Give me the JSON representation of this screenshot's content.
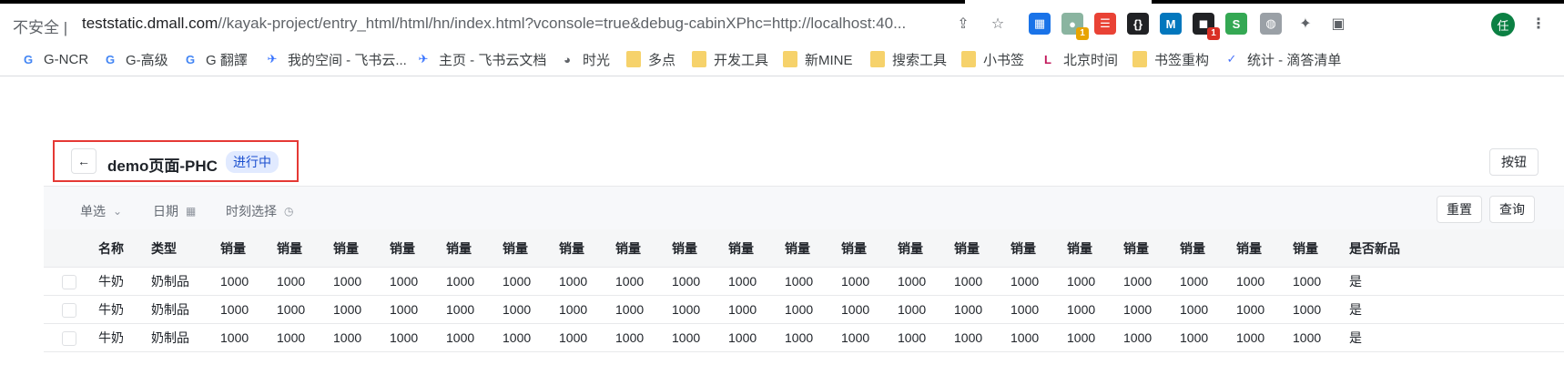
{
  "browser": {
    "security_label": "不安全",
    "url_host": "teststatic.dmall.com",
    "url_path": "//kayak-project/entry_html/html/hn/index.html?vconsole=true&debug-cabinXPhc=http://localhost:40...",
    "extensions": [
      {
        "name": "grid-ext",
        "color": "#1a73e8",
        "glyph": "▦",
        "badge": ""
      },
      {
        "name": "circle-ext",
        "color": "#8ab4a0",
        "glyph": "●",
        "badge": "1",
        "badge_color": "#e8a400"
      },
      {
        "name": "red-ext",
        "color": "#e94235",
        "glyph": "☰",
        "badge": ""
      },
      {
        "name": "json-ext",
        "color": "#202124",
        "glyph": "{}",
        "badge": ""
      },
      {
        "name": "m-ext",
        "color": "#0277bd",
        "glyph": "M",
        "badge": ""
      },
      {
        "name": "black-ext",
        "color": "#202124",
        "glyph": "◼",
        "badge": "1",
        "badge_color": "#d93025"
      },
      {
        "name": "s-ext",
        "color": "#34a853",
        "glyph": "S",
        "badge": ""
      },
      {
        "name": "globe-ext",
        "color": "#9aa0a6",
        "glyph": "◍",
        "badge": "",
        "badge_color": "#5f6368"
      }
    ],
    "avatar_text": "任"
  },
  "bookmarks": [
    {
      "label": "G-NCR",
      "icon": "google-icon",
      "glyph": "G",
      "color": "#4285f4"
    },
    {
      "label": "G-高级",
      "icon": "google-icon",
      "glyph": "G",
      "color": "#4285f4"
    },
    {
      "label": "G 翻譯",
      "icon": "translate-icon",
      "glyph": "G",
      "color": "#4285f4"
    },
    {
      "label": "我的空间 - 飞书云...",
      "icon": "feishu-icon",
      "glyph": "✈",
      "color": "#3370ff"
    },
    {
      "label": "主页 - 飞书云文档",
      "icon": "feishu-icon",
      "glyph": "✈",
      "color": "#3370ff"
    },
    {
      "label": "时光",
      "icon": "globe-icon",
      "glyph": "◕",
      "color": "#5f6368"
    },
    {
      "label": "多点",
      "icon": "folder-icon"
    },
    {
      "label": "开发工具",
      "icon": "folder-icon"
    },
    {
      "label": "新MINE",
      "icon": "folder-icon"
    },
    {
      "label": "搜索工具",
      "icon": "folder-icon"
    },
    {
      "label": "小书签",
      "icon": "folder-icon"
    },
    {
      "label": "北京时间",
      "icon": "clock-icon",
      "glyph": "L",
      "color": "#c2185b"
    },
    {
      "label": "书签重构",
      "icon": "folder-icon"
    },
    {
      "label": "统计 - 滴答清单",
      "icon": "check-icon",
      "glyph": "✓",
      "color": "#4772fa"
    }
  ],
  "page": {
    "title": "demo页面-PHC",
    "status": "进行中",
    "back_glyph": "←",
    "right_button": "按钮"
  },
  "filters": {
    "single_select": "单选",
    "date": "日期",
    "time_picker": "时刻选择",
    "reset": "重置",
    "query": "查询"
  },
  "table": {
    "headers": [
      "名称",
      "类型",
      "销量",
      "销量",
      "销量",
      "销量",
      "销量",
      "销量",
      "销量",
      "销量",
      "销量",
      "销量",
      "销量",
      "销量",
      "销量",
      "销量",
      "销量",
      "销量",
      "销量",
      "销量",
      "销量",
      "销量",
      "是否新品"
    ],
    "rows": [
      [
        "牛奶",
        "奶制品",
        "1000",
        "1000",
        "1000",
        "1000",
        "1000",
        "1000",
        "1000",
        "1000",
        "1000",
        "1000",
        "1000",
        "1000",
        "1000",
        "1000",
        "1000",
        "1000",
        "1000",
        "1000",
        "1000",
        "1000",
        "是"
      ],
      [
        "牛奶",
        "奶制品",
        "1000",
        "1000",
        "1000",
        "1000",
        "1000",
        "1000",
        "1000",
        "1000",
        "1000",
        "1000",
        "1000",
        "1000",
        "1000",
        "1000",
        "1000",
        "1000",
        "1000",
        "1000",
        "1000",
        "1000",
        "是"
      ],
      [
        "牛奶",
        "奶制品",
        "1000",
        "1000",
        "1000",
        "1000",
        "1000",
        "1000",
        "1000",
        "1000",
        "1000",
        "1000",
        "1000",
        "1000",
        "1000",
        "1000",
        "1000",
        "1000",
        "1000",
        "1000",
        "1000",
        "1000",
        "是"
      ]
    ]
  }
}
